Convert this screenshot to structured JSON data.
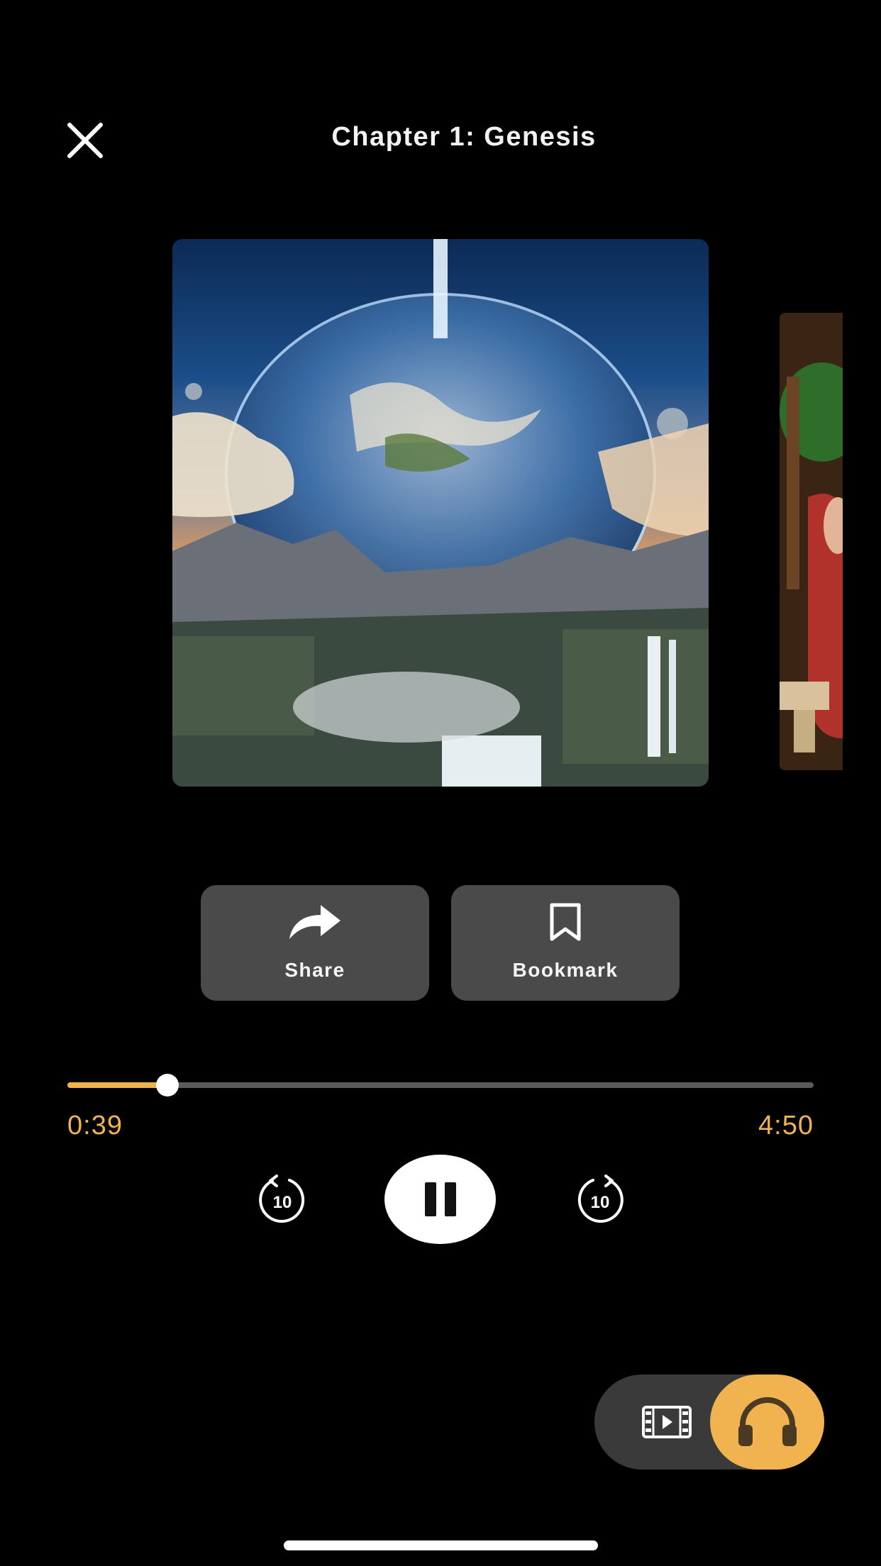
{
  "header": {
    "title": "Chapter 1: Genesis",
    "close_icon": "close-icon"
  },
  "artwork": {
    "current_cover": "genesis-cover-image",
    "next_cover": "next-chapter-cover-image"
  },
  "actions": {
    "share_label": "Share",
    "share_icon": "share-arrow-icon",
    "bookmark_label": "Bookmark",
    "bookmark_icon": "bookmark-icon"
  },
  "player": {
    "current_time": "0:39",
    "total_time": "4:50",
    "progress_fraction": 0.1345,
    "rewind_seconds": "10",
    "forward_seconds": "10",
    "state": "playing",
    "accent_color": "#f0b34f"
  },
  "mode": {
    "video_icon": "film-icon",
    "audio_icon": "headphones-icon",
    "selected": "audio"
  }
}
